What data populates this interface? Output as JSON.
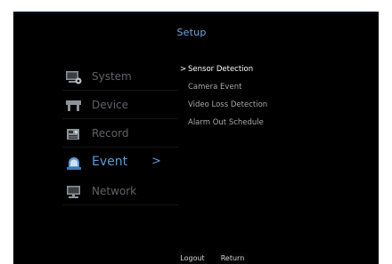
{
  "title": "Setup",
  "menu": {
    "items": [
      {
        "label": "System",
        "icon": "monitor-gear-icon"
      },
      {
        "label": "Device",
        "icon": "camera-mount-icon"
      },
      {
        "label": "Record",
        "icon": "recorder-icon"
      },
      {
        "label": "Event",
        "icon": "alarm-siren-icon",
        "chevron": ">"
      },
      {
        "label": "Network",
        "icon": "network-monitor-icon"
      }
    ],
    "active_index": 3
  },
  "submenu": {
    "marker": ">",
    "items": [
      "Sensor Detection",
      "Camera Event",
      "Video Loss Detection",
      "Alarm Out Schedule"
    ],
    "selected_index": 0
  },
  "footer": {
    "logout_label": "Logout",
    "return_label": "Return"
  },
  "colors": {
    "accent": "#5b9bd5",
    "title": "#6fa8dc",
    "inactive": "#5f6368",
    "background": "#000000"
  }
}
